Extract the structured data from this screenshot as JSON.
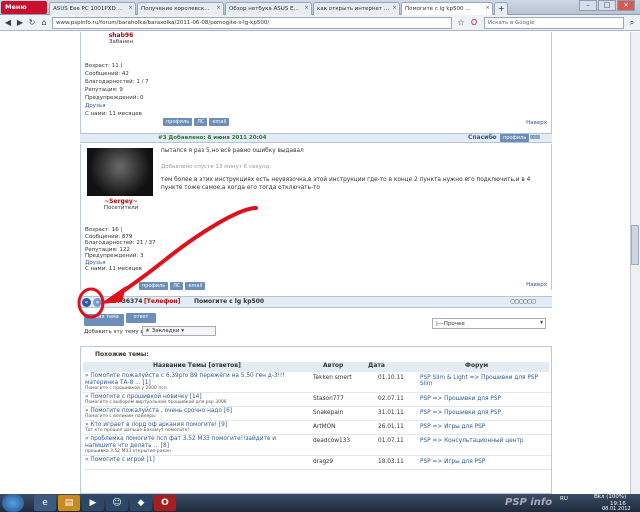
{
  "browser": {
    "menu_label": "Меню",
    "tabs": [
      {
        "label": "ASUS Eee PC 1001PXD ...",
        "active": false
      },
      {
        "label": "Получение королевск...",
        "active": false
      },
      {
        "label": "Обзор нетбука ASUS E...",
        "active": false
      },
      {
        "label": "как открыть интернет ...",
        "active": false
      },
      {
        "label": "Помогите с lg kp500 ...",
        "active": true
      }
    ],
    "url": "www.pspinfo.ru/forum/baraholka/baraxolka/2011-06-08/pomogite-s-lg-kp500/",
    "search_placeholder": "Искать в Google"
  },
  "post1": {
    "username": "shab96",
    "rank": "Забанен",
    "stats": [
      "Возраст: 11 | ",
      "Сообщений: 42",
      "Благодарностей: 1 / 7",
      "Репутация: 9",
      "Предупреждений: 0",
      "Друзья",
      "С нами: 11 месяцев"
    ],
    "buttons": [
      "профиль",
      "ЛС",
      "email"
    ],
    "top_link": "Наверх"
  },
  "post2": {
    "header": "#3 Добавлено: 8 июня 2011 20:04",
    "thanks": "Спасибо",
    "username": "~Sergey~",
    "rank": "Посетители",
    "stats": [
      "Возраст: 16 |",
      "Сообщений: 879",
      "Благодарностей: 21 / 37",
      "Репутация: 122",
      "Предупреждений: 3",
      "Друзья",
      "С нами: 11 месяцев"
    ],
    "text1": "пытался я раз 5,но всё равно ошибку выдавал",
    "added": "Добавлено спустя 13 минут 6 секунд:",
    "text2": "тем более в этих инструкциях есть неувязочка,в этой инструкции где-то в конце 2 пункта нужно его подключить,и в 4 пункте тоже самое,а когда его тогда отключать-то",
    "buttons": [
      "профиль",
      "ЛС",
      "email"
    ],
    "top_link": "Наверх"
  },
  "topic_bar": {
    "id_text": "ID: 36374",
    "tag": "[Телефон]",
    "title": "Помогите с lg kp500"
  },
  "actions": {
    "new_topic": "новая тема",
    "reply": "ответ",
    "add_to": "Добавить эту тему в",
    "bookmarks": "Закладки",
    "category": "|---Прочее"
  },
  "similar": {
    "title": "Похожие темы:",
    "headers": [
      "Название Темы [ответов]",
      "Автор",
      "Дата",
      "Форум"
    ],
    "rows": [
      {
        "title": "» Помогите пожалуйста с 6.39pro B9 пережёги на 5.50 ген д-3!!! материнка ТА-8 ... [1]",
        "desc": "Помогите с прошивкой у 2000 псп",
        "author": "Tekken smert",
        "date": "01.10.11",
        "forum": "PSP Slim & Light => Прошивки для PSP Slim"
      },
      {
        "title": "» Помогите с прошивкой новичку [14]",
        "desc": "Помогите с выбором виртуальной прошивкой для psp 3006",
        "author": "Stason777",
        "date": "02.07.11",
        "forum": "PSP => Прошивки для PSP"
      },
      {
        "title": "» Помогите пожалуйста , очень срочно надо [6]",
        "desc": "Помогите с великим пайлеры",
        "author": "Snakepain",
        "date": "31.01.11",
        "forum": "PSP => Прошивки для PSP"
      },
      {
        "title": "» Кто играет в лорд оф аркания помогите! [9]",
        "desc": "Тот кто прошел дальше Бахамут помогите!",
        "author": "ArtMON",
        "date": "26.01.11",
        "forum": "PSP => Игры для PSP"
      },
      {
        "title": "» проблемка помогите псп фат 3.52 M33 помогите!!зайдите и напишите что делать ... [8]",
        "desc": "прошивка 3.52 M33 открытие ракан",
        "author": "deadcow133",
        "date": "01.07.11",
        "forum": "PSP => Консультационный центр"
      },
      {
        "title": "» Помогите с игрой [1]",
        "desc": "",
        "author": "dragz9",
        "date": "18.03.11",
        "forum": "PSP => Игры для PSP"
      }
    ]
  },
  "taskbar": {
    "brand": "PSP info",
    "language": "RU",
    "battery": "Bkл (100%)",
    "time": "19:16",
    "date": "08.01.2012"
  },
  "colors": {
    "annotation": "#e0101a",
    "accent": "#2a5a9a"
  }
}
